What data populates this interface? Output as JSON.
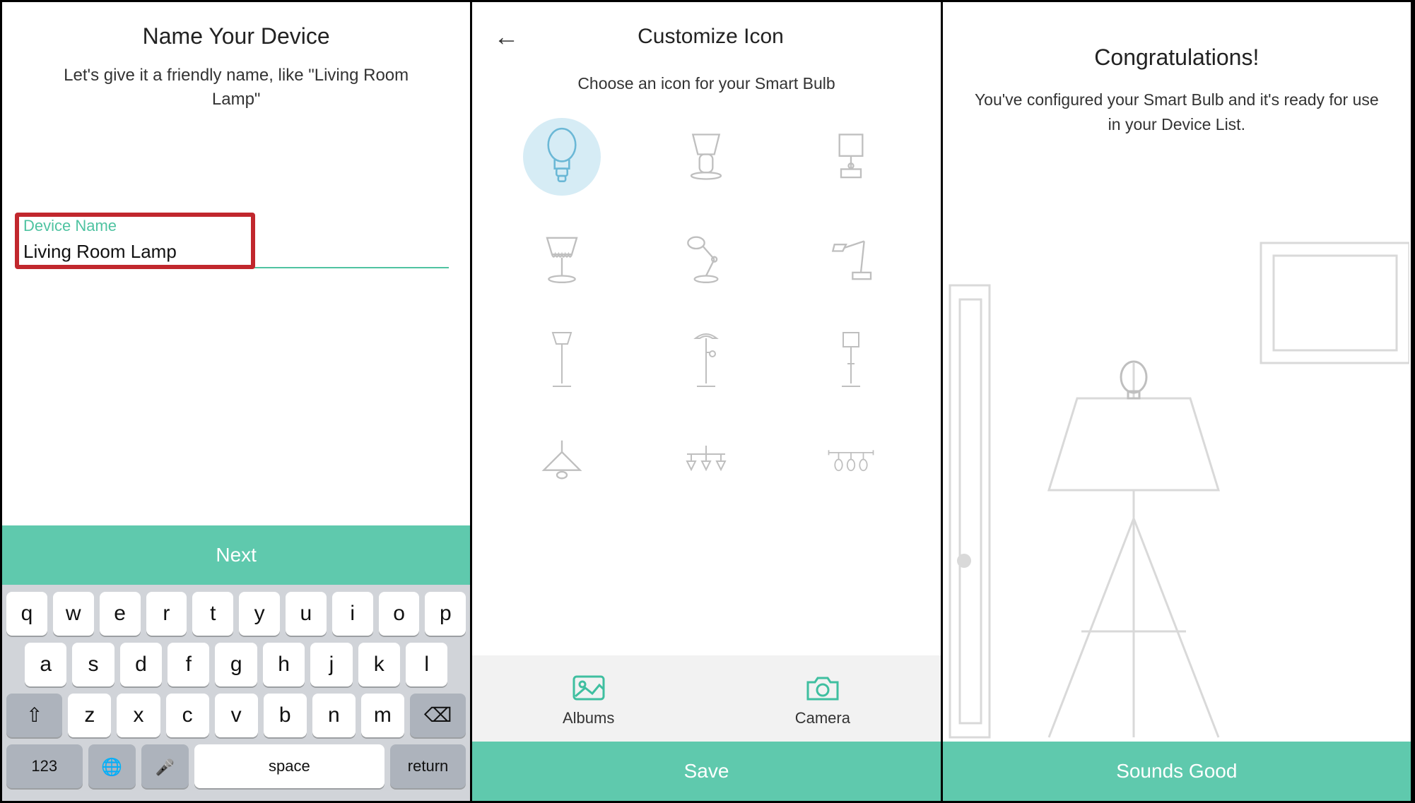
{
  "panel1": {
    "title": "Name Your Device",
    "subtitle": "Let's give it a friendly name, like \"Living Room Lamp\"",
    "field_label": "Device Name",
    "device_name_value": "Living Room Lamp",
    "next_label": "Next",
    "keyboard": {
      "row1": [
        "q",
        "w",
        "e",
        "r",
        "t",
        "y",
        "u",
        "i",
        "o",
        "p"
      ],
      "row2": [
        "a",
        "s",
        "d",
        "f",
        "g",
        "h",
        "j",
        "k",
        "l"
      ],
      "row3": [
        "z",
        "x",
        "c",
        "v",
        "b",
        "n",
        "m"
      ],
      "numbers_key": "123",
      "space_key": "space",
      "return_key": "return"
    }
  },
  "panel2": {
    "title": "Customize Icon",
    "subtitle": "Choose an icon for your Smart Bulb",
    "icons": [
      "bulb",
      "table-lamp-shade",
      "desk-lamp-box",
      "table-lamp-frill",
      "adjustable-desk-lamp",
      "arm-desk-lamp",
      "floor-lamp",
      "torchiere",
      "floor-lamp-box",
      "pendant",
      "chandelier-3",
      "track-3"
    ],
    "selected_icon_index": 0,
    "albums_label": "Albums",
    "camera_label": "Camera",
    "save_label": "Save"
  },
  "panel3": {
    "title": "Congratulations!",
    "subtitle": "You've configured your Smart Bulb and it's ready for use in your Device List.",
    "done_label": "Sounds Good"
  }
}
